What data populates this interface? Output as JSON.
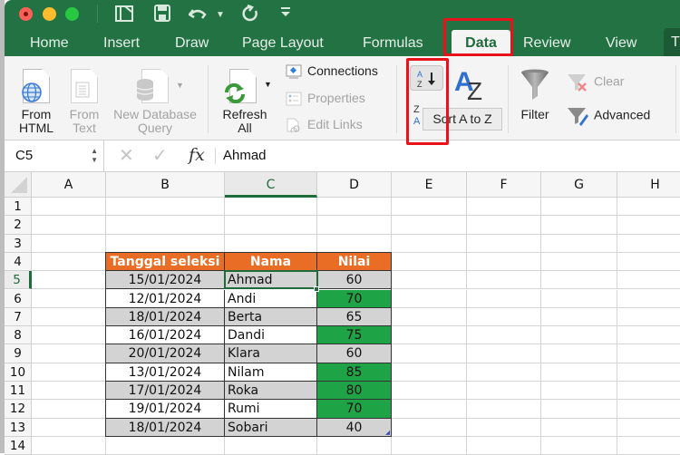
{
  "window": {
    "traffic_lights": [
      "close",
      "minimize",
      "zoom"
    ],
    "quick_access": [
      {
        "name": "sidebar-toggle-icon",
        "glyph": "▯"
      },
      {
        "name": "save-icon",
        "glyph": "💾"
      },
      {
        "name": "undo-icon",
        "glyph": "↶"
      },
      {
        "name": "undo-dropdown-icon",
        "glyph": "▾"
      },
      {
        "name": "redo-icon",
        "glyph": "↻"
      },
      {
        "name": "customize-toolbar-icon",
        "glyph": "⩡"
      }
    ]
  },
  "ribbon_tabs": {
    "home": "Home",
    "insert": "Insert",
    "draw": "Draw",
    "page_layout": "Page Layout",
    "formulas": "Formulas",
    "data": "Data",
    "review": "Review",
    "view": "View",
    "truncated": "T",
    "active": "Data"
  },
  "ribbon": {
    "from_html": {
      "line1": "From",
      "line2": "HTML"
    },
    "from_text": {
      "line1": "From",
      "line2": "Text"
    },
    "new_db_query": {
      "line1": "New Database",
      "line2": "Query"
    },
    "refresh_all": {
      "line1": "Refresh",
      "line2": "All"
    },
    "connections": "Connections",
    "properties": "Properties",
    "edit_links": "Edit Links",
    "sort_az_icon": "A↓Z",
    "sort_big_icon": "AZ",
    "filter": "Filter",
    "clear": "Clear",
    "advanced": "Advanced",
    "tooltip": "Sort A to Z"
  },
  "formula_bar": {
    "name_box": "C5",
    "cancel_glyph": "✕",
    "enter_glyph": "✓",
    "fx_label": "fx",
    "value": "Ahmad"
  },
  "sheet": {
    "columns": [
      "A",
      "B",
      "C",
      "D",
      "E",
      "F",
      "G",
      "H"
    ],
    "selected_column": "C",
    "selected_row": "5",
    "rows": [
      "1",
      "2",
      "3",
      "4",
      "5",
      "6",
      "7",
      "8",
      "9",
      "10",
      "11",
      "12",
      "13",
      "14"
    ],
    "table": {
      "headers": [
        "Tanggal seleksi",
        "Nama",
        "Nilai"
      ],
      "rows": [
        {
          "tanggal": "15/01/2024",
          "nama": "Ahmad",
          "nilai": "60"
        },
        {
          "tanggal": "12/01/2024",
          "nama": "Andi",
          "nilai": "70"
        },
        {
          "tanggal": "18/01/2024",
          "nama": "Berta",
          "nilai": "65"
        },
        {
          "tanggal": "16/01/2024",
          "nama": "Dandi",
          "nilai": "75"
        },
        {
          "tanggal": "20/01/2024",
          "nama": "Klara",
          "nilai": "60"
        },
        {
          "tanggal": "13/01/2024",
          "nama": "Nilam",
          "nilai": "85"
        },
        {
          "tanggal": "17/01/2024",
          "nama": "Roka",
          "nilai": "80"
        },
        {
          "tanggal": "19/01/2024",
          "nama": "Rumi",
          "nilai": "70"
        },
        {
          "tanggal": "18/01/2024",
          "nama": "Sobari",
          "nilai": "40"
        }
      ],
      "highlighted_nilai_rows": [
        1,
        3,
        5,
        6,
        7
      ],
      "colors": {
        "header": "#e96d25",
        "stripe": "#d3d3d3",
        "highlight": "#1ea446"
      }
    }
  },
  "annotations": {
    "highlight_color": "#e8121b"
  }
}
